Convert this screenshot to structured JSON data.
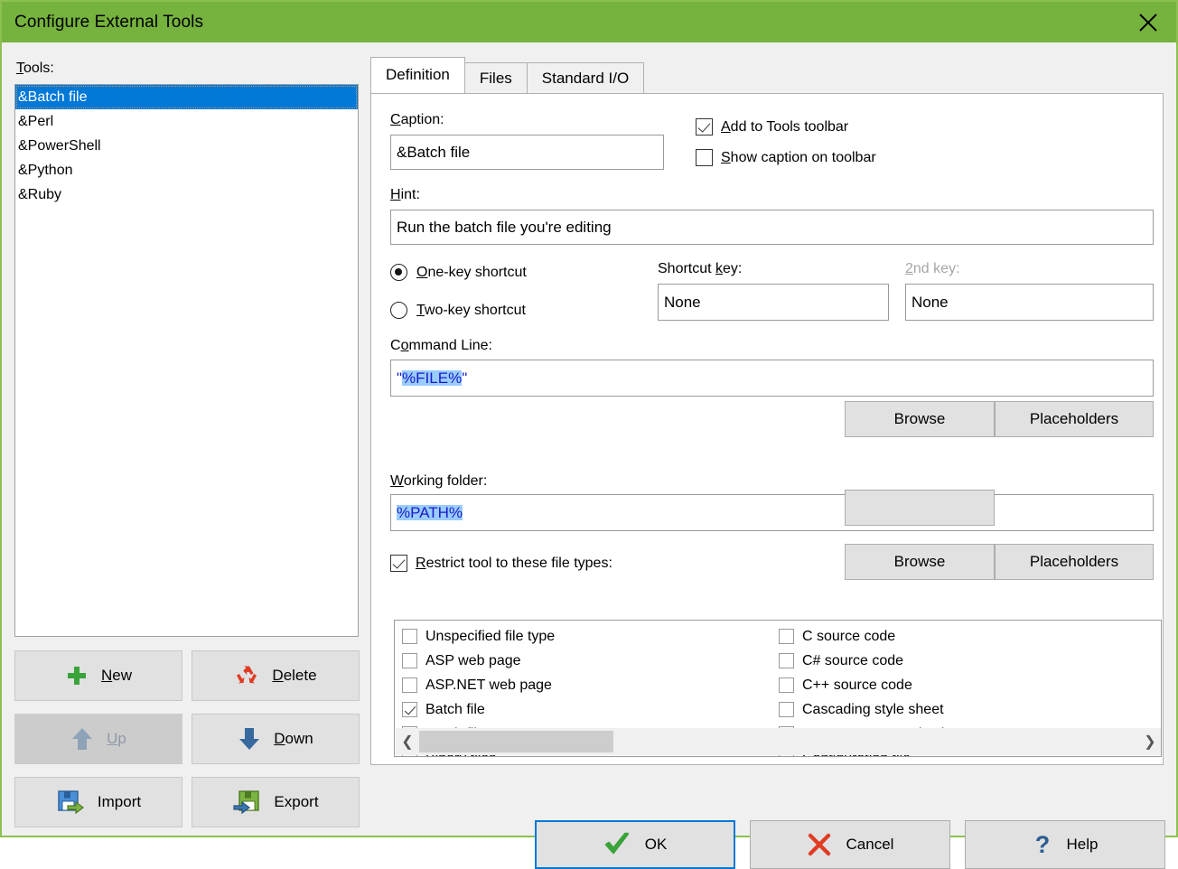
{
  "window": {
    "title": "Configure External Tools",
    "titlebar_color": "#76b23e",
    "close_icon": "close-icon"
  },
  "left_panel": {
    "tools_label": "Tools:",
    "tools": [
      {
        "label": "&Batch file",
        "selected": true
      },
      {
        "label": "&Perl",
        "selected": false
      },
      {
        "label": "&PowerShell",
        "selected": false
      },
      {
        "label": "&Python",
        "selected": false
      },
      {
        "label": "&Ruby",
        "selected": false
      }
    ],
    "buttons": [
      {
        "label_pre": "",
        "label_acc": "N",
        "label_post": "ew",
        "icon": "plus-icon",
        "enabled": true
      },
      {
        "label_pre": "",
        "label_acc": "D",
        "label_post": "elete",
        "icon": "recycle-icon",
        "enabled": true
      },
      {
        "label_pre": "",
        "label_acc": "U",
        "label_post": "p",
        "icon": "arrow-up-icon",
        "enabled": false
      },
      {
        "label_pre": "",
        "label_acc": "D",
        "label_post": "own",
        "icon": "arrow-down-icon",
        "enabled": true
      },
      {
        "label_pre": "Import",
        "label_acc": "",
        "label_post": "",
        "icon": "import-disk-icon",
        "enabled": true
      },
      {
        "label_pre": "Export",
        "label_acc": "",
        "label_post": "",
        "icon": "export-disk-icon",
        "enabled": true
      }
    ]
  },
  "tabs": [
    {
      "label": "Definition",
      "active": true
    },
    {
      "label": "Files",
      "active": false
    },
    {
      "label": "Standard I/O",
      "active": false
    }
  ],
  "definition": {
    "caption_label_acc": "C",
    "caption_label_rest": "aption:",
    "caption_value": "&Batch file",
    "add_to_toolbar": {
      "acc": "A",
      "rest": "dd to Tools toolbar",
      "checked": true
    },
    "show_caption": {
      "acc": "S",
      "rest": "how caption on toolbar",
      "checked": false
    },
    "hint_label_acc": "H",
    "hint_label_rest": "int:",
    "hint_value": "Run the batch file you're editing",
    "one_key": {
      "acc": "O",
      "rest": "ne-key shortcut",
      "selected": true
    },
    "two_key": {
      "acc": "T",
      "rest": "wo-key shortcut",
      "selected": false
    },
    "shortcut_key_label_pre": "Shortcut ",
    "shortcut_key_label_acc": "k",
    "shortcut_key_label_post": "ey:",
    "shortcut_key_value": "None",
    "second_key_label_acc": "2",
    "second_key_label_rest": "nd key:",
    "second_key_value": "None",
    "second_key_disabled": true,
    "command_line_label_pre": "C",
    "command_line_label_acc": "o",
    "command_line_label_post": "mmand Line:",
    "command_line_quote_open": "\"",
    "command_line_placeholder": "%FILE%",
    "command_line_quote_close": "\"",
    "working_folder_label_acc": "W",
    "working_folder_label_rest": "orking folder:",
    "working_folder_value": "%PATH%",
    "browse_label": "Browse",
    "placeholders_label": "Placeholders",
    "restrict": {
      "pre": "",
      "acc": "R",
      "rest": "estrict tool to these file types:",
      "checked": true
    },
    "file_types_col1": [
      {
        "label": "Unspecified file type",
        "checked": false
      },
      {
        "label": "ASP web page",
        "checked": false
      },
      {
        "label": "ASP.NET web page",
        "checked": false
      },
      {
        "label": "Batch file",
        "checked": true
      },
      {
        "label": "Batch file output",
        "checked": false
      },
      {
        "label": "Binary files",
        "checked": false
      }
    ],
    "file_types_col2": [
      {
        "label": "C source code",
        "checked": false
      },
      {
        "label": "C# source code",
        "checked": false
      },
      {
        "label": "C++ source code",
        "checked": false
      },
      {
        "label": "Cascading style sheet",
        "checked": false
      },
      {
        "label": "Comma-separated values",
        "checked": false
      },
      {
        "label": "Configuration file",
        "checked": false
      }
    ],
    "scroll_left_icon": "chevron-left-icon",
    "scroll_right_icon": "chevron-right-icon"
  },
  "dialog_buttons": {
    "ok": "OK",
    "cancel": "Cancel",
    "help": "Help"
  },
  "colors": {
    "titlebar": "#76b23e",
    "selection": "#0078d7",
    "placeholder_highlight": "#99ccff",
    "placeholder_text": "#1a1ac8",
    "ok_check": "#3aa33a",
    "cancel_x": "#e03c23",
    "help_blue": "#2c5d91"
  }
}
